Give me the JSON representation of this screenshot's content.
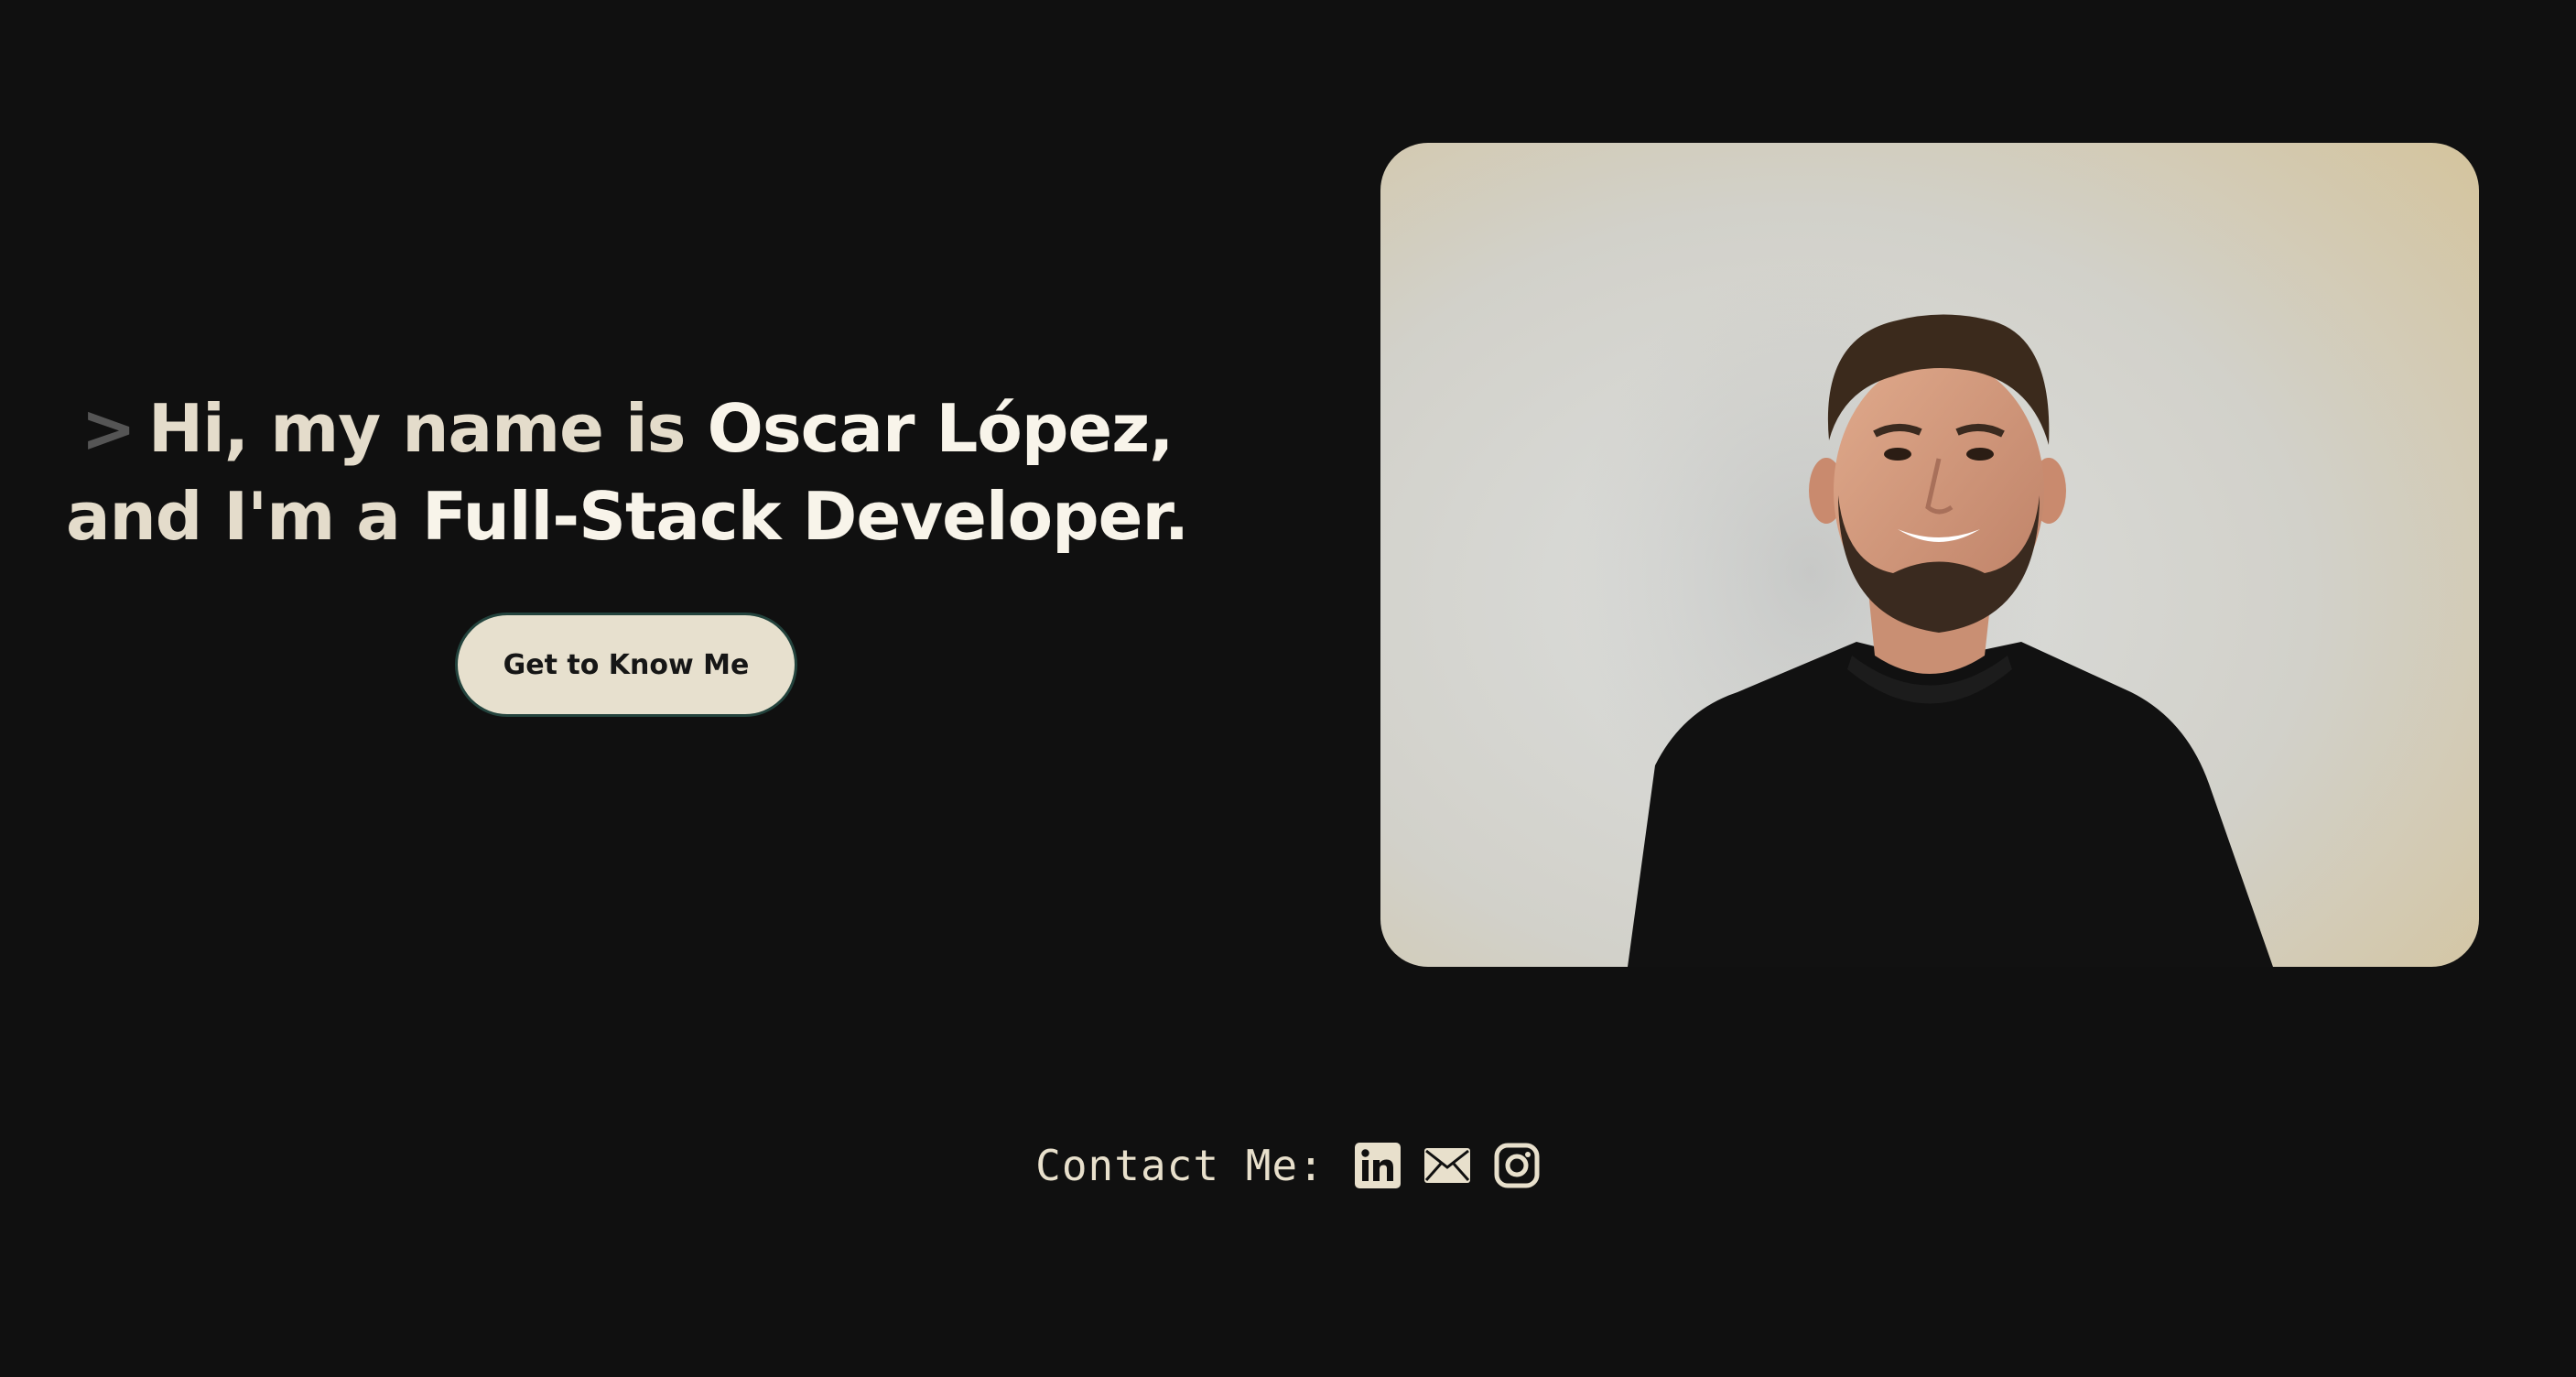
{
  "hero": {
    "prompt": ">",
    "line1_plain": "Hi, my name is",
    "line1_name": "Oscar López,",
    "line2_plain": "and I'm a",
    "line2_role": "Full-Stack Developer."
  },
  "cta": {
    "label": "Get to Know Me"
  },
  "contact": {
    "label": "Contact Me:",
    "icons": [
      "linkedin-icon",
      "email-icon",
      "instagram-icon"
    ]
  },
  "colors": {
    "background": "#101010",
    "accent": "#e7e0ce",
    "button_border": "#23433d"
  }
}
